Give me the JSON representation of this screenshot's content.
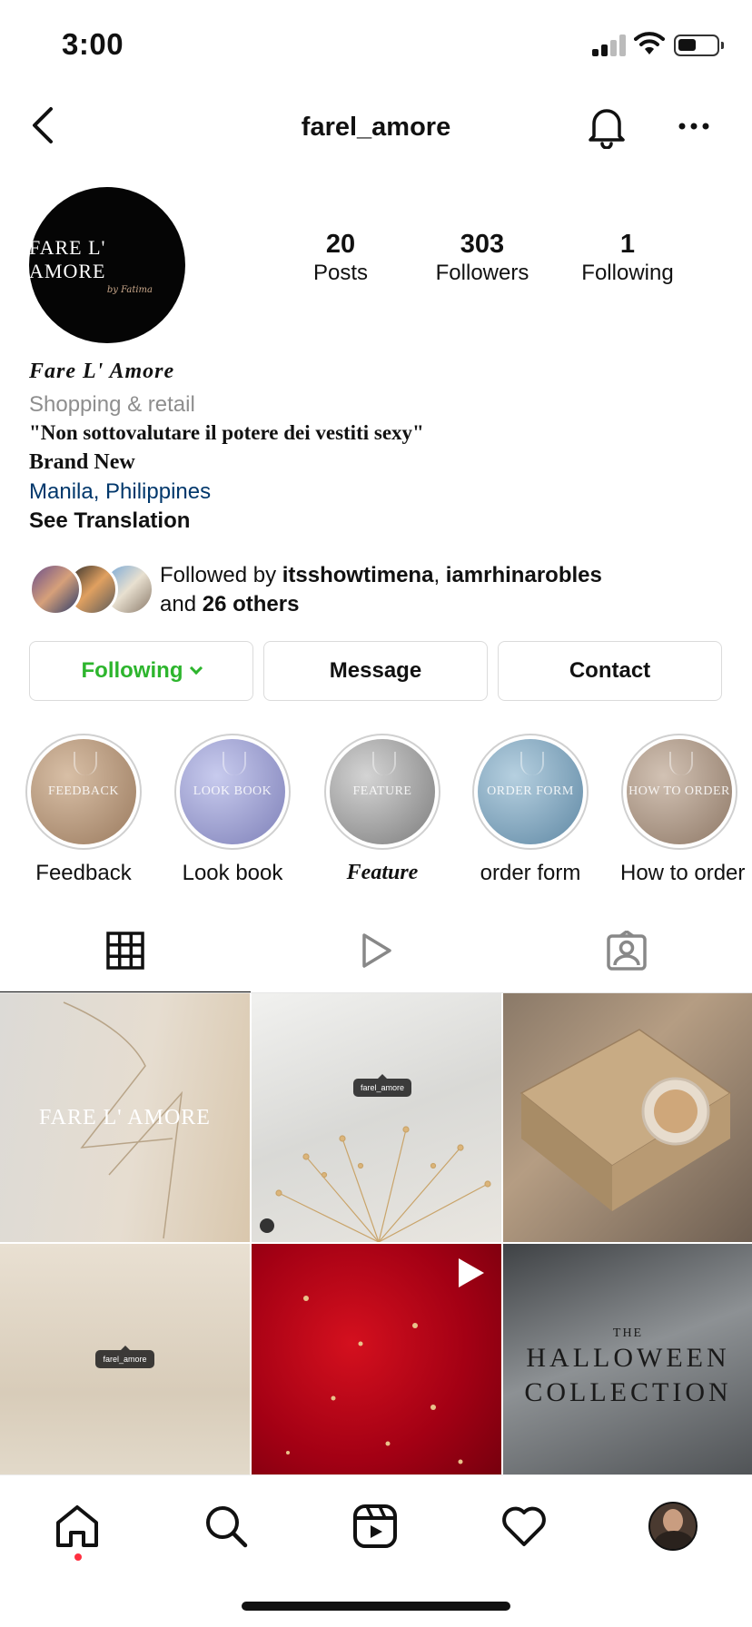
{
  "status_bar": {
    "time": "3:00"
  },
  "header": {
    "username": "farel_amore"
  },
  "profile": {
    "avatar_brand": "FARE L' AMORE",
    "avatar_signature": "by Fatima",
    "stats": [
      {
        "value": "20",
        "label": "Posts"
      },
      {
        "value": "303",
        "label": "Followers"
      },
      {
        "value": "1",
        "label": "Following"
      }
    ],
    "name": "Fare L' Amore",
    "category": "Shopping & retail",
    "bio_quote": "\"Non sottovalutare il potere dei vestiti sexy\"",
    "bio_line2": "Brand New",
    "location": "Manila, Philippines",
    "see_translation": "See Translation",
    "followed_by": {
      "prefix": "Followed by ",
      "user1": "itsshowtimena",
      "sep": ", ",
      "user2": "iamrhinarobles",
      "and": "and ",
      "others": "26 others"
    }
  },
  "actions": {
    "following": "Following",
    "message": "Message",
    "contact": "Contact"
  },
  "highlights": [
    {
      "title": "Feedback",
      "cover_text": "FEEDBACK",
      "color": "#a88a70"
    },
    {
      "title": "Look book",
      "cover_text": "LOOK BOOK",
      "color": "#9a9cc8"
    },
    {
      "title": "Feature",
      "cover_text": "FEATURE",
      "color": "#9c9c9c"
    },
    {
      "title": "order form",
      "cover_text": "ORDER FORM",
      "color": "#7fa3ba"
    },
    {
      "title": "How to order",
      "cover_text": "HOW TO ORDER",
      "color": "#a89384"
    }
  ],
  "tabs": [
    "grid-icon",
    "reels-icon",
    "tagged-icon"
  ],
  "posts": {
    "p1_text": "FARE L' AMORE",
    "p2_tag": "farel_amore",
    "p4_tag": "farel_amore",
    "p6_small": "THE",
    "p6_line1": "HALLOWEEN",
    "p6_line2": "COLLECTION"
  },
  "colors": {
    "following_green": "#2db52d",
    "location_blue": "#00376b",
    "notification_dot": "#ff3040"
  }
}
